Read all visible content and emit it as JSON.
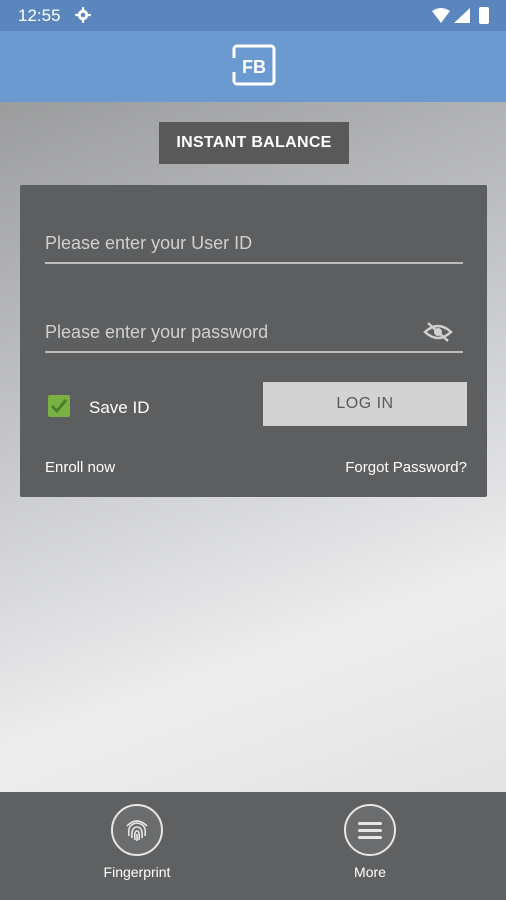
{
  "status_bar": {
    "time": "12:55"
  },
  "app_bar": {
    "logo_text": "FB"
  },
  "main": {
    "instant_balance_label": "INSTANT BALANCE",
    "login_card": {
      "user_id_placeholder": "Please enter your User ID",
      "password_placeholder": "Please enter your password",
      "save_id_label": "Save ID",
      "save_id_checked": true,
      "login_button_label": "LOG IN",
      "enroll_link": "Enroll now",
      "forgot_link": "Forgot Password?"
    }
  },
  "bottom_nav": {
    "items": [
      {
        "label": "Fingerprint",
        "icon": "fingerprint-icon"
      },
      {
        "label": "More",
        "icon": "menu-icon"
      }
    ]
  },
  "colors": {
    "status_bar": "#5a86bd",
    "app_bar": "#6a9ad0",
    "card": "#5d5e5f",
    "checkbox": "#7ab143"
  }
}
